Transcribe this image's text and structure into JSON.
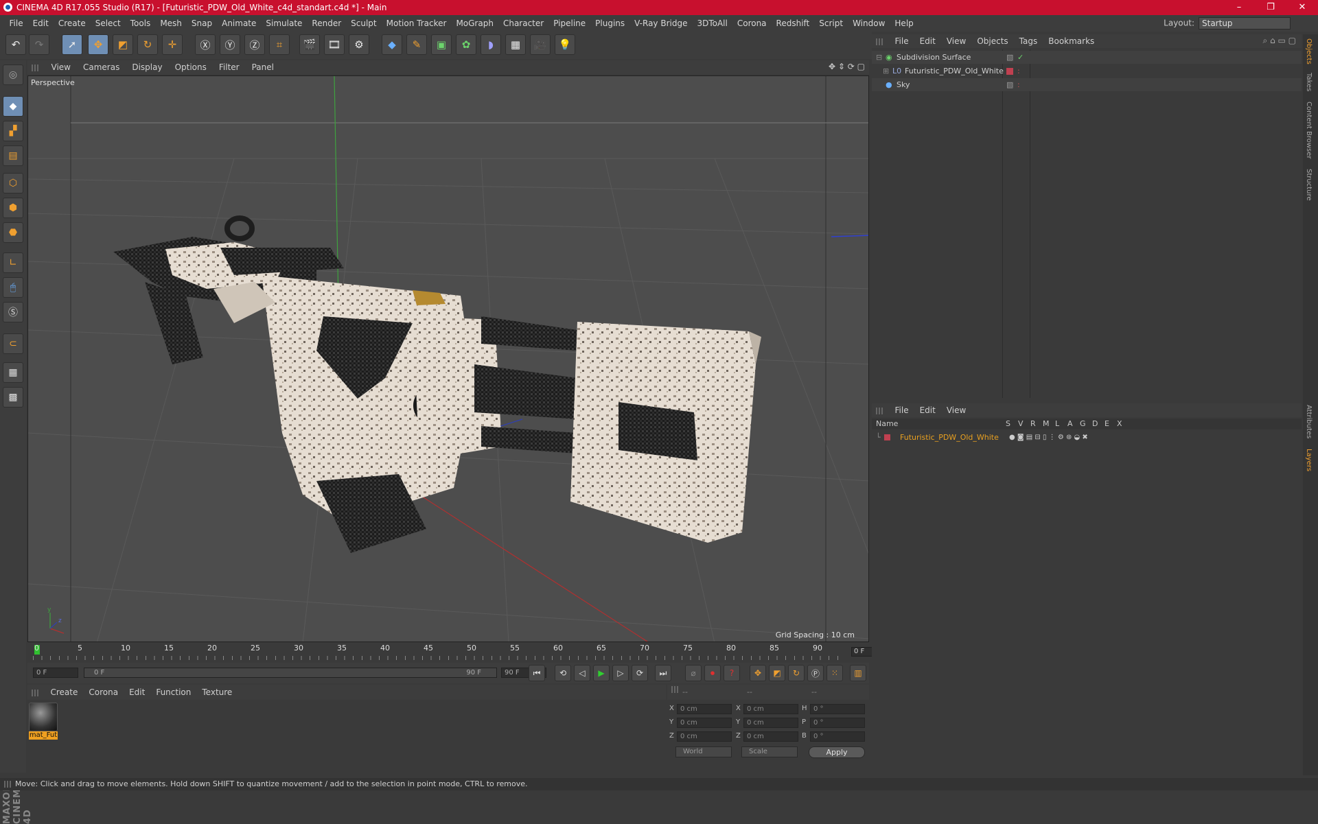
{
  "window": {
    "title": "CINEMA 4D R17.055 Studio (R17) - [Futuristic_PDW_Old_White_c4d_standart.c4d *] - Main"
  },
  "menubar": [
    "File",
    "Edit",
    "Create",
    "Select",
    "Tools",
    "Mesh",
    "Snap",
    "Animate",
    "Simulate",
    "Render",
    "Sculpt",
    "Motion Tracker",
    "MoGraph",
    "Character",
    "Pipeline",
    "Plugins",
    "V-Ray Bridge",
    "3DToAll",
    "Corona",
    "Redshift",
    "Script",
    "Window",
    "Help"
  ],
  "layout": {
    "label": "Layout:",
    "value": "Startup"
  },
  "viewport": {
    "menu": [
      "View",
      "Cameras",
      "Display",
      "Options",
      "Filter",
      "Panel"
    ],
    "camera_label": "Perspective",
    "grid_spacing": "Grid Spacing : 10 cm"
  },
  "timeline": {
    "ticks": [
      "0",
      "5",
      "10",
      "15",
      "20",
      "25",
      "30",
      "35",
      "40",
      "45",
      "50",
      "55",
      "60",
      "65",
      "70",
      "75",
      "80",
      "85",
      "90"
    ],
    "current_frame": "0 F",
    "start_field": "0 F",
    "range_start": "0 F",
    "range_end": "90 F",
    "end_field": "90 F"
  },
  "material_manager": {
    "menu": [
      "Create",
      "Corona",
      "Edit",
      "Function",
      "Texture"
    ],
    "materials": [
      {
        "label": "mat_Fut"
      }
    ]
  },
  "coordinates": {
    "headers": [
      "--",
      "--",
      "--"
    ],
    "rows": [
      {
        "l1": "X",
        "v1": "0 cm",
        "l2": "X",
        "v2": "0 cm",
        "l3": "H",
        "v3": "0 °"
      },
      {
        "l1": "Y",
        "v1": "0 cm",
        "l2": "Y",
        "v2": "0 cm",
        "l3": "P",
        "v3": "0 °"
      },
      {
        "l1": "Z",
        "v1": "0 cm",
        "l2": "Z",
        "v2": "0 cm",
        "l3": "B",
        "v3": "0 °"
      }
    ],
    "mode": "World",
    "size_mode": "Scale",
    "apply": "Apply"
  },
  "object_manager": {
    "menu": [
      "File",
      "Edit",
      "View",
      "Objects",
      "Tags",
      "Bookmarks"
    ],
    "objects": [
      {
        "name": "Subdivision Surface",
        "color": "#cfcfcf"
      },
      {
        "name": "Futuristic_PDW_Old_White",
        "color": "#cfcfcf"
      },
      {
        "name": "Sky",
        "color": "#cfcfcf"
      }
    ]
  },
  "layer_manager": {
    "menu": [
      "File",
      "Edit",
      "View"
    ],
    "columns": {
      "name": "Name",
      "flags": [
        "S",
        "V",
        "R",
        "M",
        "L",
        "A",
        "G",
        "D",
        "E",
        "X"
      ]
    },
    "layers": [
      {
        "name": "Futuristic_PDW_Old_White",
        "color": "#e8a020"
      }
    ]
  },
  "side_tabs": [
    "Objects",
    "Takes",
    "Content Browser",
    "Structure",
    "Attributes",
    "Layers"
  ],
  "status": "Move: Click and drag to move elements. Hold down SHIFT to quantize movement / add to the selection in point mode, CTRL to remove.",
  "colors": {
    "titlebar": "#c8102e",
    "accent": "#f0a020",
    "layer_color": "#c04050"
  }
}
